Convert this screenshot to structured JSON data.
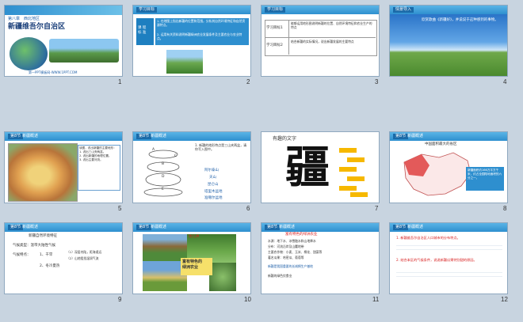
{
  "slides": [
    {
      "num": "1",
      "chapter": "第八章　西北地区",
      "title": "新疆维吾尔自治区",
      "footer": "第一PPT模板网-WWW.1PPT.COM"
    },
    {
      "num": "2",
      "header": "学习目标",
      "label": "课 程\n标 准",
      "text1": "1. 在地图上指出新疆的位置和范围，分析其自然环境特征和自然资源特点。",
      "text2": "2. 运用有关资料说明新疆绿洲农业发展条件及主要农业与农业特点。"
    },
    {
      "num": "3",
      "header": "学习目标",
      "row1": "学习目标1",
      "row2": "学习目标2",
      "cell1": "能够运用地形图说明新疆的位置、自然环境特征和农业生产的特点",
      "cell2": "结合新疆的实际情况，说出新疆发展的主要特点"
    },
    {
      "num": "4",
      "header": "情景导入",
      "text": "欣赏歌曲《新疆好》，并说说于这种感到的事物。"
    },
    {
      "num": "5",
      "tag": "第8节",
      "header": "新疆概述",
      "box": "读图，说出新疆的主要地形：\n1. 说出三山夹两盆。\n2. 说出新疆的地理位置。\n3. 说出主要河流。"
    },
    {
      "num": "6",
      "tag": "第8节",
      "header": "新疆概述",
      "text": "1. 新疆的地形特点是三山夹两盆，请你写入图中。",
      "labels": [
        "阿尔泰山",
        "天山",
        "昆仑山",
        "塔里木盆地",
        "准噶尔盆地"
      ],
      "letters": [
        "A",
        "B",
        "C",
        "D",
        "E"
      ]
    },
    {
      "num": "7",
      "title": "有趣的文字",
      "glyph": "疆"
    },
    {
      "num": "8",
      "tag": "第8节",
      "header": "新疆概述",
      "title": "中国面积最大的省区",
      "note": "新疆面积约166万平方千米，约占全国陆地面积的六分之一。"
    },
    {
      "num": "9",
      "tag": "第8节",
      "header": "新疆概述",
      "t1": "新疆自然环境特征",
      "t2": "气候类型：温带大陆性气候",
      "t3": "气候特点：",
      "t4": "1、干旱",
      "t5": "（1）深居内陆，距海遥远",
      "t6": "（2）山地阻挡湿润气流",
      "t7": "2、冬冷夏热"
    },
    {
      "num": "10",
      "tag": "第8节",
      "header": "新疆概述",
      "caption1": "坎儿井",
      "caption2": "富有特色的\n绿洲农业"
    },
    {
      "num": "11",
      "tag": "第8节",
      "header": "新疆概述",
      "title": "富有特色的绿洲农业",
      "lines": [
        "水源：地下水、冰雪融水和山地降水",
        "分布：河流沿岸及山麓地带",
        "主要农作物：小麦、玉米、棉花、甜菜等",
        "著名瓜果：哈密瓜、葡萄等",
        "新疆是我国重要的长绒棉生产基地",
        "新疆的绿色饮食业"
      ]
    },
    {
      "num": "12",
      "tag": "第8节",
      "header": "新疆概述",
      "line1": "1. 新疆维吾尔自治区人口城市的分布特点。",
      "line2": "2. 结合本区的气候条件，说说新疆瓜果特别甜的原因。"
    }
  ],
  "colors": {
    "accent": "#2e8fcf",
    "title_red": "#d82020",
    "orange": "#f6b800"
  }
}
